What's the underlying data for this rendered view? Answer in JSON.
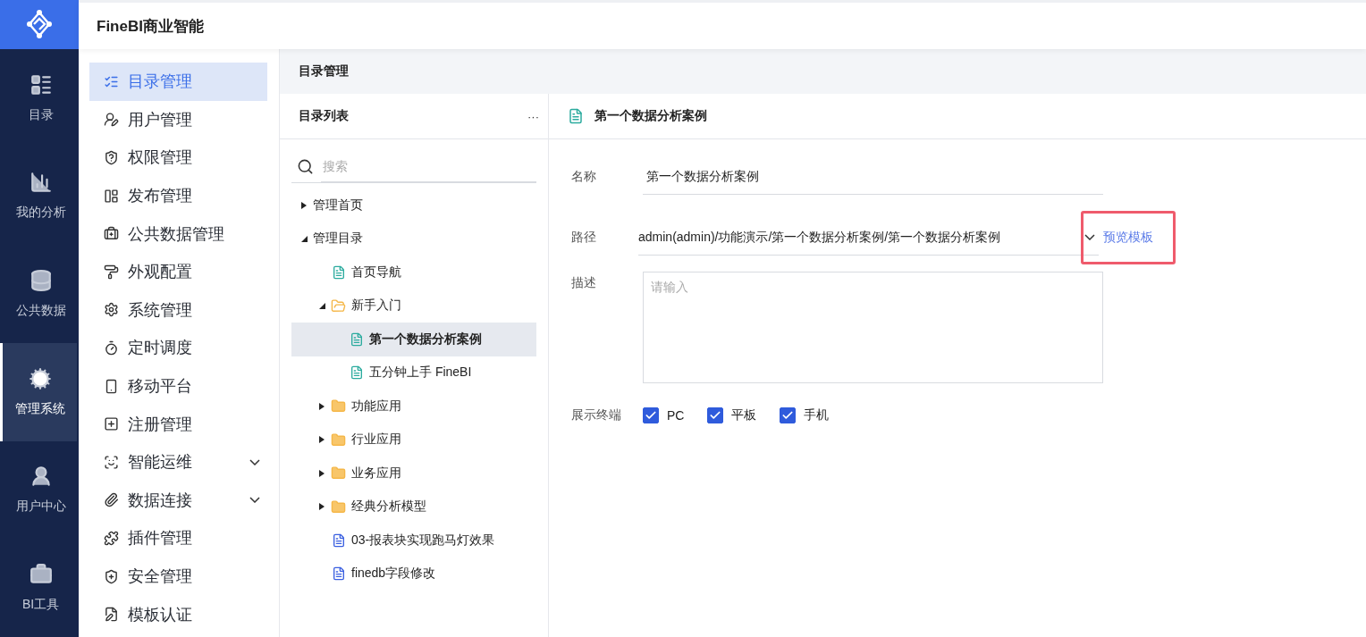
{
  "app": {
    "title": "FineBI商业智能"
  },
  "nav": [
    {
      "label": "目录",
      "selected": false
    },
    {
      "label": "我的分析",
      "selected": false
    },
    {
      "label": "公共数据",
      "selected": false
    },
    {
      "label": "管理系统",
      "selected": true
    },
    {
      "label": "用户中心",
      "selected": false
    },
    {
      "label": "BI工具",
      "selected": false
    }
  ],
  "menu": [
    {
      "label": "目录管理",
      "selected": true,
      "expandable": false
    },
    {
      "label": "用户管理",
      "selected": false,
      "expandable": false
    },
    {
      "label": "权限管理",
      "selected": false,
      "expandable": false
    },
    {
      "label": "发布管理",
      "selected": false,
      "expandable": false
    },
    {
      "label": "公共数据管理",
      "selected": false,
      "expandable": false
    },
    {
      "label": "外观配置",
      "selected": false,
      "expandable": false
    },
    {
      "label": "系统管理",
      "selected": false,
      "expandable": false
    },
    {
      "label": "定时调度",
      "selected": false,
      "expandable": false
    },
    {
      "label": "移动平台",
      "selected": false,
      "expandable": false
    },
    {
      "label": "注册管理",
      "selected": false,
      "expandable": false
    },
    {
      "label": "智能运维",
      "selected": false,
      "expandable": true
    },
    {
      "label": "数据连接",
      "selected": false,
      "expandable": true
    },
    {
      "label": "插件管理",
      "selected": false,
      "expandable": false
    },
    {
      "label": "安全管理",
      "selected": false,
      "expandable": false
    },
    {
      "label": "模板认证",
      "selected": false,
      "expandable": false
    }
  ],
  "breadcrumb": "目录管理",
  "tree_panel": {
    "title": "目录列表",
    "more": "···",
    "search_placeholder": "搜索",
    "items": [
      {
        "label": "管理首页",
        "kind": "node",
        "expanded": false,
        "selected": false
      },
      {
        "label": "管理目录",
        "kind": "node",
        "expanded": true,
        "selected": false,
        "children": [
          {
            "label": "首页导航",
            "kind": "dashboard",
            "selected": false
          },
          {
            "label": "新手入门",
            "kind": "folder",
            "expanded": true,
            "selected": false,
            "children": [
              {
                "label": "第一个数据分析案例",
                "kind": "dashboard",
                "selected": true
              },
              {
                "label": "五分钟上手 FineBI",
                "kind": "dashboard",
                "selected": false
              }
            ]
          },
          {
            "label": "功能应用",
            "kind": "folder",
            "expanded": false,
            "selected": false
          },
          {
            "label": "行业应用",
            "kind": "folder",
            "expanded": false,
            "selected": false
          },
          {
            "label": "业务应用",
            "kind": "folder",
            "expanded": false,
            "selected": false
          },
          {
            "label": "经典分析模型",
            "kind": "folder",
            "expanded": false,
            "selected": false
          },
          {
            "label": "03-报表块实现跑马灯效果",
            "kind": "report",
            "selected": false
          },
          {
            "label": "finedb字段修改",
            "kind": "report",
            "selected": false
          }
        ]
      }
    ]
  },
  "detail": {
    "title": "第一个数据分析案例",
    "name": {
      "label": "名称",
      "value": "第一个数据分析案例"
    },
    "path": {
      "label": "路径",
      "value": "admin(admin)/功能演示/第一个数据分析案例/第一个数据分析案例"
    },
    "preview": {
      "label": "预览模板",
      "highlighted": true
    },
    "description": {
      "label": "描述",
      "placeholder": "请输入"
    },
    "terminals": {
      "label": "展示终端",
      "options": [
        {
          "label": "PC",
          "checked": true
        },
        {
          "label": "平板",
          "checked": true
        },
        {
          "label": "手机",
          "checked": true
        }
      ]
    }
  }
}
